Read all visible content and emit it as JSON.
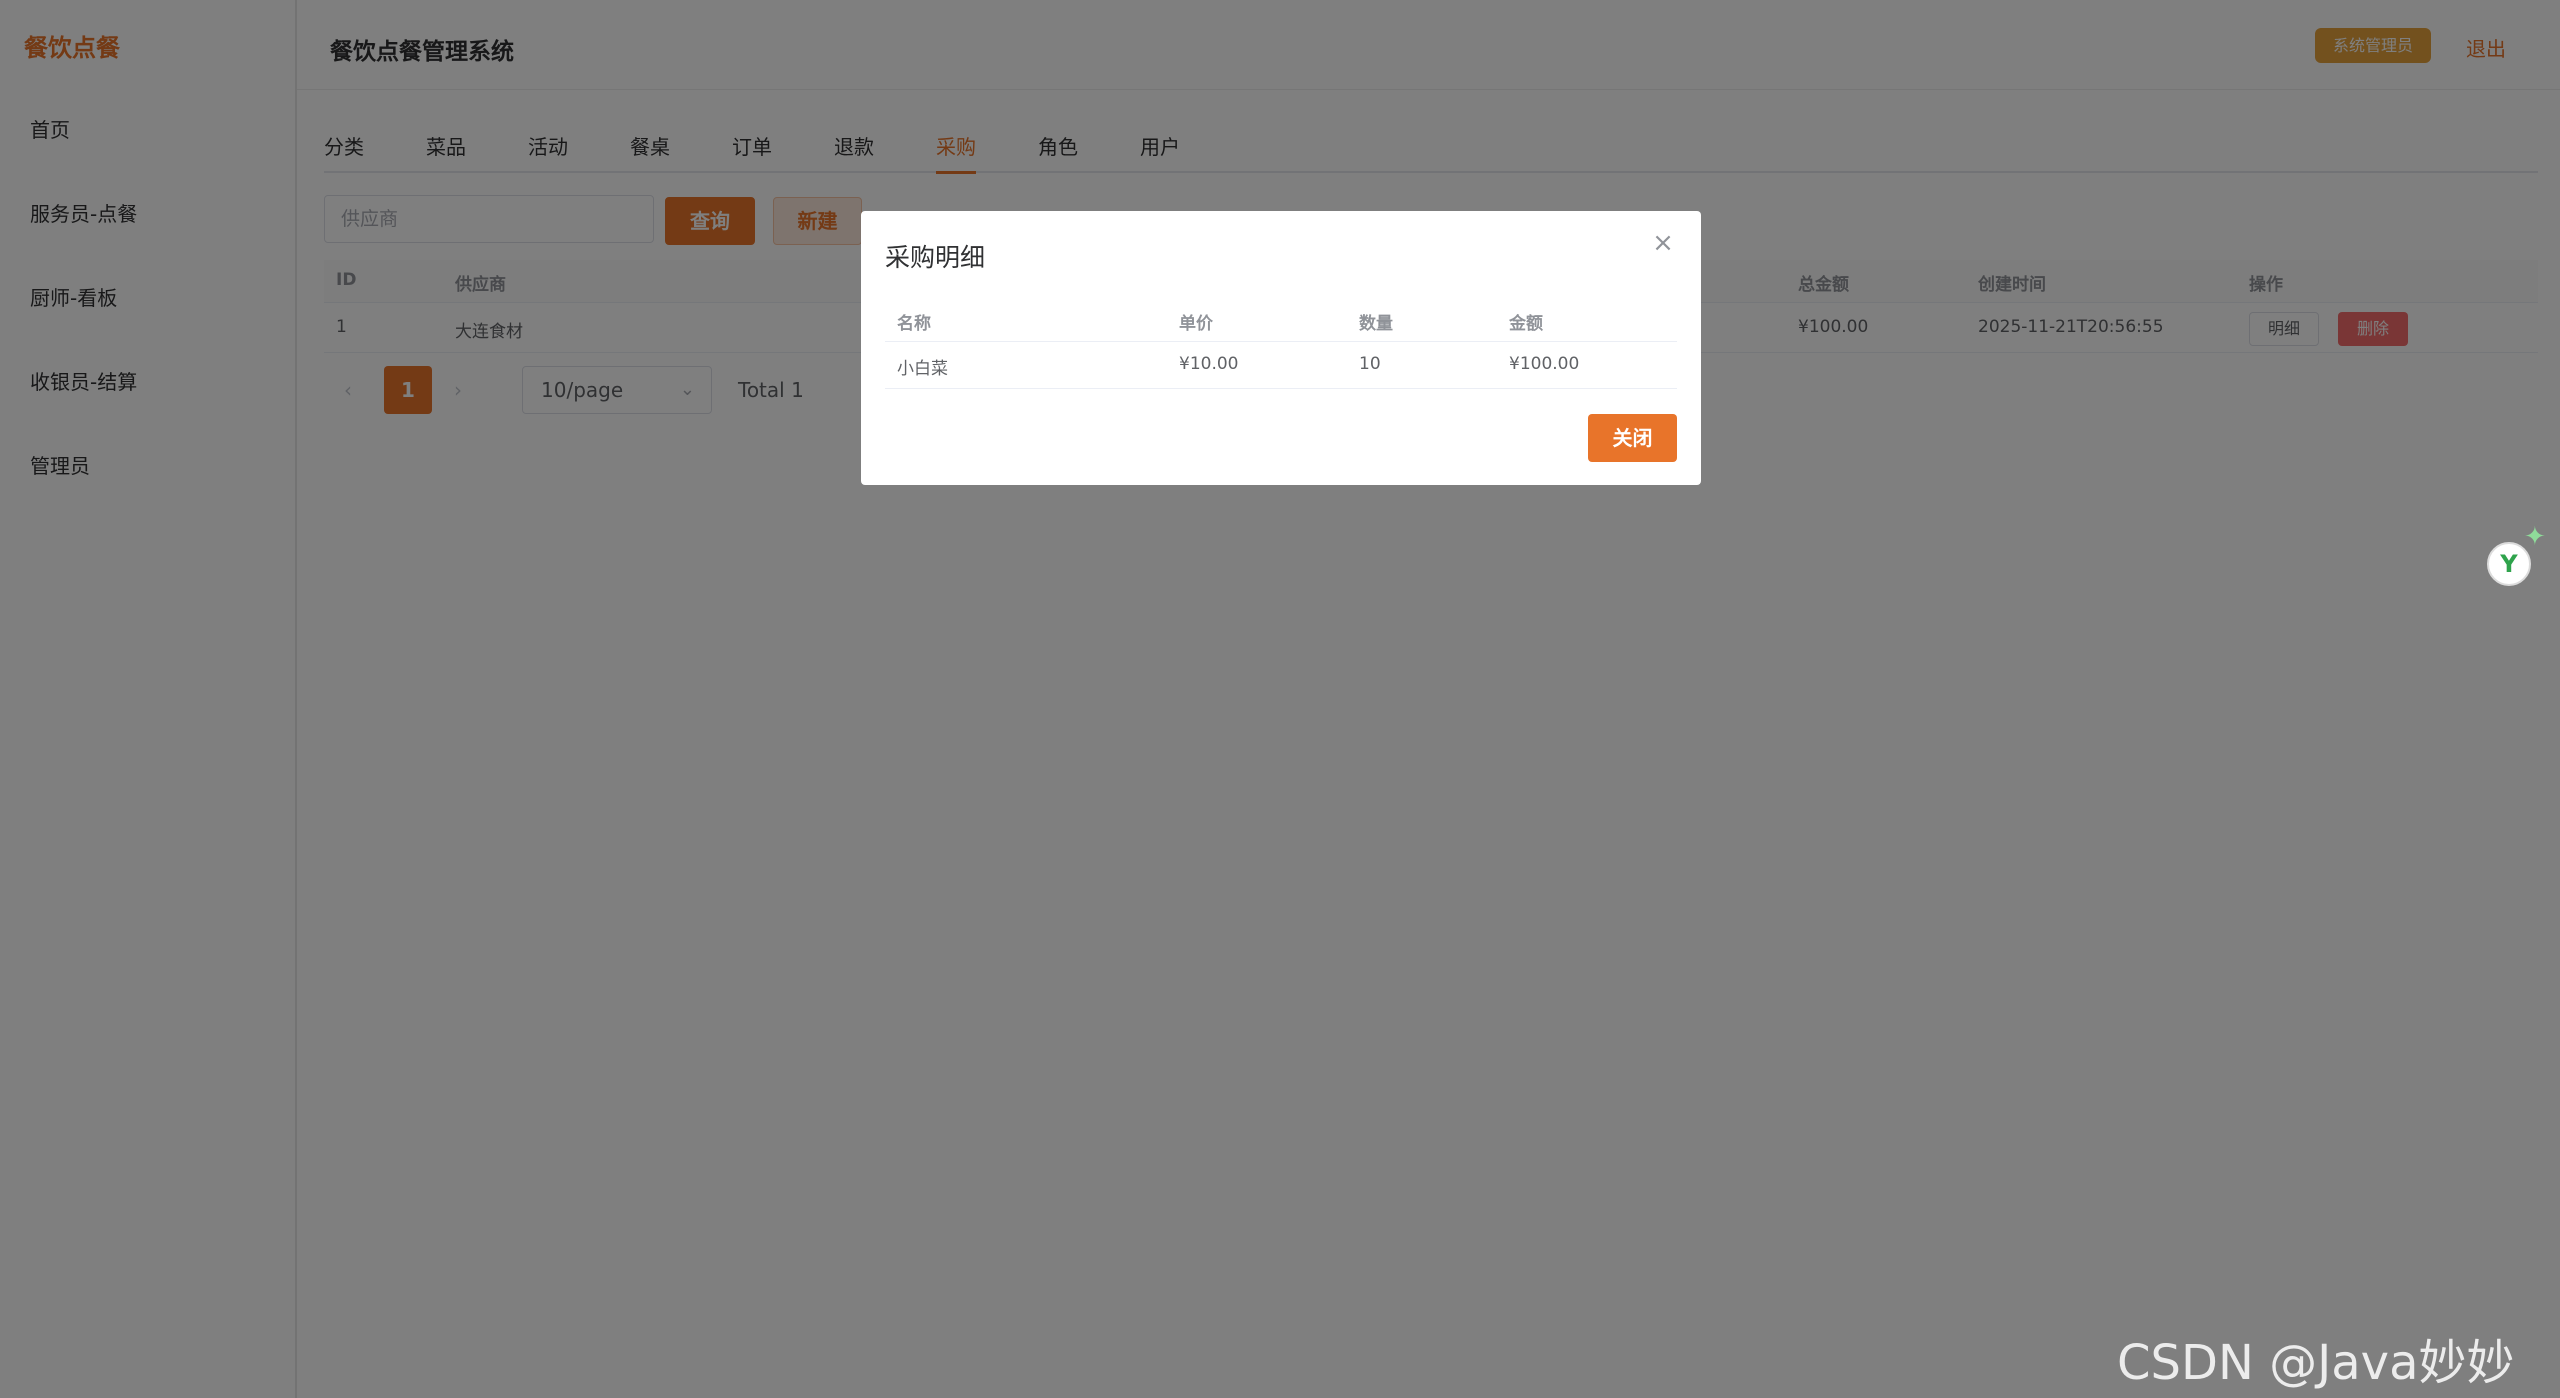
{
  "sidebar": {
    "brand": "餐饮点餐",
    "items": [
      {
        "label": "首页"
      },
      {
        "label": "服务员-点餐"
      },
      {
        "label": "厨师-看板"
      },
      {
        "label": "收银员-结算"
      },
      {
        "label": "管理员"
      }
    ]
  },
  "header": {
    "title": "餐饮点餐管理系统",
    "role_badge": "系统管理员",
    "logout": "退出"
  },
  "tabs": [
    {
      "label": "分类"
    },
    {
      "label": "菜品"
    },
    {
      "label": "活动"
    },
    {
      "label": "餐桌"
    },
    {
      "label": "订单"
    },
    {
      "label": "退款"
    },
    {
      "label": "采购",
      "active": true
    },
    {
      "label": "角色"
    },
    {
      "label": "用户"
    }
  ],
  "toolbar": {
    "search_placeholder": "供应商",
    "query_label": "查询",
    "new_label": "新建"
  },
  "table": {
    "columns": {
      "id": "ID",
      "supplier": "供应商",
      "total": "总金额",
      "created": "创建时间",
      "actions": "操作"
    },
    "rows": [
      {
        "id": "1",
        "supplier": "大连食材",
        "total": "¥100.00",
        "created": "2025-11-21T20:56:55",
        "detail_label": "明细",
        "delete_label": "删除"
      }
    ]
  },
  "pagination": {
    "prev": "‹",
    "current": "1",
    "next": "›",
    "page_size": "10/page",
    "total": "Total 1"
  },
  "dialog": {
    "title": "采购明细",
    "close_icon": "×",
    "columns": {
      "name": "名称",
      "unit_price": "单价",
      "quantity": "数量",
      "amount": "金额"
    },
    "rows": [
      {
        "name": "小白菜",
        "unit_price": "¥10.00",
        "quantity": "10",
        "amount": "¥100.00"
      }
    ],
    "close_label": "关闭"
  },
  "floating": {
    "letter": "Y",
    "spark": "✦"
  },
  "watermark": "CSDN @Java妙妙屋",
  "colors": {
    "accent": "#e8742a",
    "badge": "#e6a23c",
    "danger": "#f56c6c"
  }
}
